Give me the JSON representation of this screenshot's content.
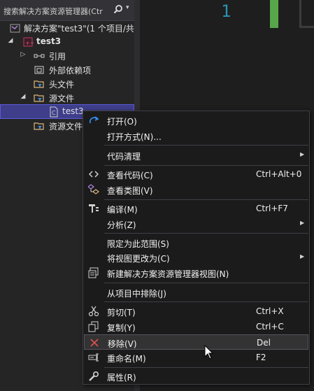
{
  "search": {
    "placeholder": "搜索解决方案资源管理器(Ctr"
  },
  "tree": {
    "solution": "解决方案\"test3\"(1 个项目/共",
    "project": "test3",
    "references": "引用",
    "external_deps": "外部依赖项",
    "headers": "头文件",
    "sources": "源文件",
    "selected_file": "test3",
    "resources": "资源文件"
  },
  "editor": {
    "line_number": "1"
  },
  "menu": {
    "items": [
      {
        "label": "打开(O)",
        "shortcut": ""
      },
      {
        "label": "打开方式(N)...",
        "shortcut": ""
      },
      {
        "label": "代码清理",
        "shortcut": ""
      },
      {
        "label": "查看代码(C)",
        "shortcut": "Ctrl+Alt+0"
      },
      {
        "label": "查看类图(V)",
        "shortcut": ""
      },
      {
        "label": "编译(M)",
        "shortcut": "Ctrl+F7"
      },
      {
        "label": "分析(Z)",
        "shortcut": ""
      },
      {
        "label": "限定为此范围(S)",
        "shortcut": ""
      },
      {
        "label": "将视图更改为(C)",
        "shortcut": ""
      },
      {
        "label": "新建解决方案资源管理器视图(N)",
        "shortcut": ""
      },
      {
        "label": "从项目中排除(J)",
        "shortcut": ""
      },
      {
        "label": "剪切(T)",
        "shortcut": "Ctrl+X"
      },
      {
        "label": "复制(Y)",
        "shortcut": "Ctrl+C"
      },
      {
        "label": "移除(V)",
        "shortcut": "Del"
      },
      {
        "label": "重命名(M)",
        "shortcut": "F2"
      },
      {
        "label": "属性(R)",
        "shortcut": ""
      }
    ]
  },
  "colors": {
    "accent": "#3e3e8a",
    "line_number": "#2b91af",
    "change_bar": "#57a64a",
    "remove_icon": "#e05050"
  }
}
